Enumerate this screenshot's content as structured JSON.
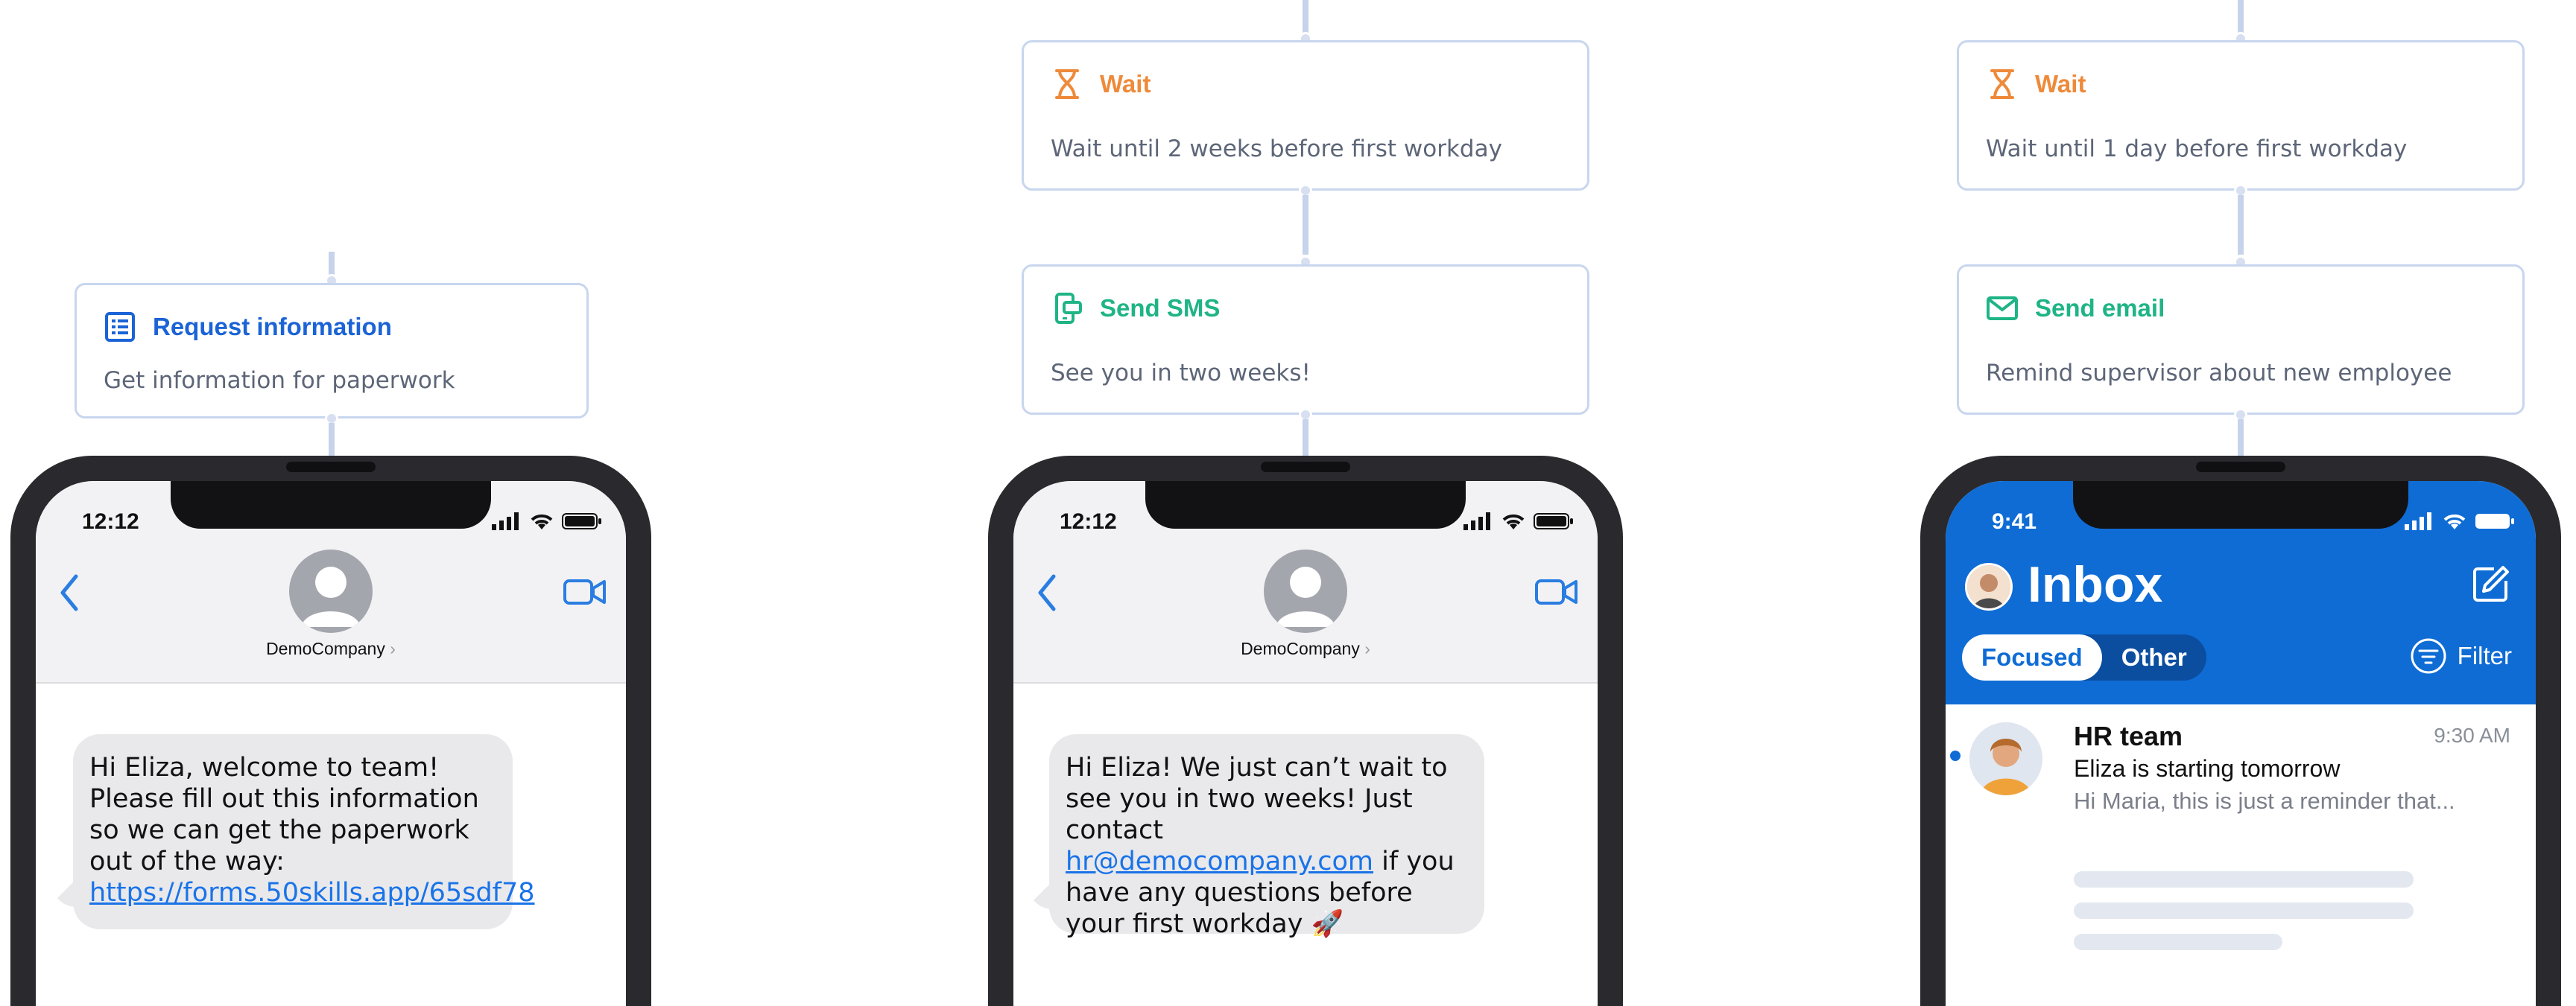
{
  "flow": {
    "col1": {
      "card": {
        "icon": "form-list-icon",
        "title": "Request information",
        "description": "Get information for paperwork"
      }
    },
    "col2": {
      "wait": {
        "icon": "hourglass-icon",
        "title": "Wait",
        "description": "Wait until 2 weeks before first workday"
      },
      "action": {
        "icon": "phone-sms-icon",
        "title": "Send SMS",
        "description": "See you in two weeks!"
      }
    },
    "col3": {
      "wait": {
        "icon": "hourglass-icon",
        "title": "Wait",
        "description": "Wait until 1 day before first workday"
      },
      "action": {
        "icon": "envelope-icon",
        "title": "Send email",
        "description": "Remind supervisor about new employee"
      }
    }
  },
  "phones": {
    "sms1": {
      "time": "12:12",
      "contact": "DemoCompany",
      "message_text": "Hi Eliza, welcome to team! Please fill out this information so we can get the paperwork out of the way: ",
      "message_link": "https://forms.50skills.app/65sdf78"
    },
    "sms2": {
      "time": "12:12",
      "contact": "DemoCompany",
      "message_before": "Hi Eliza! We just can’t wait to see you in two weeks! Just contact ",
      "message_link": "hr@democompany.com",
      "message_after": " if you have any questions before your first workday 🚀"
    },
    "outlook": {
      "time": "9:41",
      "title": "Inbox",
      "tabs": [
        "Focused",
        "Other"
      ],
      "filter": "Filter",
      "email": {
        "sender": "HR team",
        "time": "9:30 AM",
        "subject": "Eliza is starting tomorrow",
        "preview": "Hi Maria, this is just a reminder that..."
      }
    }
  },
  "colors": {
    "connector": "#c6d3ea",
    "card_border": "#c8d6ee",
    "blue": "#1b63d6",
    "orange": "#ee8a3a",
    "green": "#1fb486",
    "outlook_blue": "#0f6cd5"
  }
}
